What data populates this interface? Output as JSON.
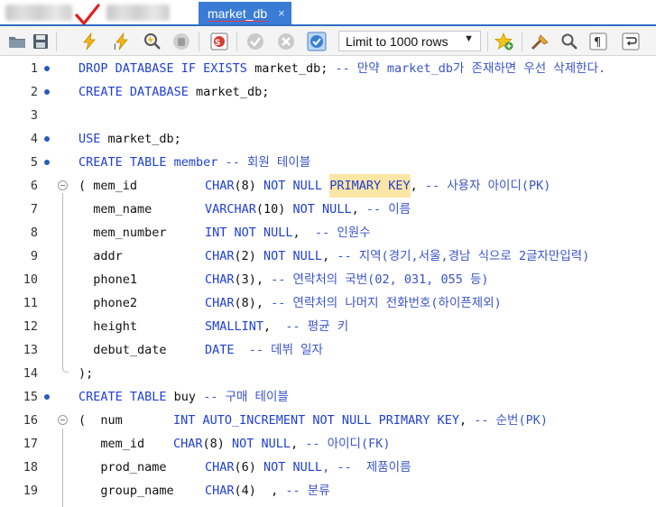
{
  "tabs": [
    {
      "label": "market_db",
      "active": true,
      "close_glyph": "×"
    }
  ],
  "toolbar": {
    "limit_select_value": "Limit to 1000 rows",
    "icons": [
      "open-folder-icon",
      "save-icon",
      "execute-icon",
      "execute-selection-icon",
      "explain-icon",
      "stop-icon",
      "toggle-error-stop-icon",
      "commit-icon",
      "rollback-icon",
      "autocommit-icon",
      "bookmark-star-icon",
      "beautify-icon",
      "find-icon",
      "invisible-chars-icon",
      "wrap-icon"
    ]
  },
  "editor": {
    "lines": [
      {
        "num": "1",
        "bullet": true,
        "fold": false,
        "tokens": [
          {
            "t": "DROP DATABASE IF EXISTS ",
            "c": "kw"
          },
          {
            "t": "market_db; ",
            "c": ""
          },
          {
            "t": "-- 만약 market_db가 존재하면 우선 삭제한다.",
            "c": "cm"
          }
        ]
      },
      {
        "num": "2",
        "bullet": true,
        "fold": false,
        "tokens": [
          {
            "t": "CREATE DATABASE ",
            "c": "kw"
          },
          {
            "t": "market_db;",
            "c": ""
          }
        ]
      },
      {
        "num": "3",
        "bullet": false,
        "fold": false,
        "tokens": []
      },
      {
        "num": "4",
        "bullet": true,
        "fold": false,
        "tokens": [
          {
            "t": "USE ",
            "c": "kw"
          },
          {
            "t": "market_db;",
            "c": ""
          }
        ]
      },
      {
        "num": "5",
        "bullet": true,
        "fold": false,
        "tokens": [
          {
            "t": "CREATE TABLE ",
            "c": "kw"
          },
          {
            "t": "member ",
            "c": "kw"
          },
          {
            "t": "-- 회원 테이블",
            "c": "cm"
          }
        ]
      },
      {
        "num": "6",
        "bullet": false,
        "fold": true,
        "tokens": [
          {
            "t": "( mem_id",
            "c": ""
          },
          {
            "t": "CHAR",
            "c": "kw",
            "col": 227
          },
          {
            "t": "(8) ",
            "c": ""
          },
          {
            "t": "NOT NULL ",
            "c": "kw"
          },
          {
            "t": "PRIMARY KEY",
            "c": "kw hl"
          },
          {
            "t": ", ",
            "c": ""
          },
          {
            "t": "-- 사용자 아이디(PK)",
            "c": "cm"
          }
        ]
      },
      {
        "num": "7",
        "bullet": false,
        "fold": false,
        "tokens": [
          {
            "t": "  mem_name",
            "c": ""
          },
          {
            "t": "VARCHAR",
            "c": "kw",
            "col": 227
          },
          {
            "t": "(10) ",
            "c": ""
          },
          {
            "t": "NOT NULL",
            "c": "kw"
          },
          {
            "t": ", ",
            "c": ""
          },
          {
            "t": "-- 이름",
            "c": "cm"
          }
        ]
      },
      {
        "num": "8",
        "bullet": false,
        "fold": false,
        "tokens": [
          {
            "t": "  mem_number",
            "c": ""
          },
          {
            "t": "INT NOT NULL",
            "c": "kw",
            "col": 227
          },
          {
            "t": ",  ",
            "c": ""
          },
          {
            "t": "-- 인원수",
            "c": "cm"
          }
        ]
      },
      {
        "num": "9",
        "bullet": false,
        "fold": false,
        "tokens": [
          {
            "t": "  addr",
            "c": ""
          },
          {
            "t": "CHAR",
            "c": "kw",
            "col": 227
          },
          {
            "t": "(2) ",
            "c": ""
          },
          {
            "t": "NOT NULL",
            "c": "kw"
          },
          {
            "t": ", ",
            "c": ""
          },
          {
            "t": "-- 지역(경기,서울,경남 식으로 2글자만입력)",
            "c": "cm"
          }
        ]
      },
      {
        "num": "10",
        "bullet": false,
        "fold": false,
        "tokens": [
          {
            "t": "  phone1",
            "c": ""
          },
          {
            "t": "CHAR",
            "c": "kw",
            "col": 227
          },
          {
            "t": "(3), ",
            "c": ""
          },
          {
            "t": "-- 연락처의 국번(02, 031, 055 등)",
            "c": "cm"
          }
        ]
      },
      {
        "num": "11",
        "bullet": false,
        "fold": false,
        "tokens": [
          {
            "t": "  phone2",
            "c": ""
          },
          {
            "t": "CHAR",
            "c": "kw",
            "col": 227
          },
          {
            "t": "(8), ",
            "c": ""
          },
          {
            "t": "-- 연락처의 나머지 전화번호(하이픈제외)",
            "c": "cm"
          }
        ]
      },
      {
        "num": "12",
        "bullet": false,
        "fold": false,
        "tokens": [
          {
            "t": "  height",
            "c": ""
          },
          {
            "t": "SMALLINT",
            "c": "kw",
            "col": 227
          },
          {
            "t": ",  ",
            "c": ""
          },
          {
            "t": "-- 평균 키",
            "c": "cm"
          }
        ]
      },
      {
        "num": "13",
        "bullet": false,
        "fold": false,
        "tokens": [
          {
            "t": "  debut_date",
            "c": ""
          },
          {
            "t": "DATE",
            "c": "kw",
            "col": 227
          },
          {
            "t": "  ",
            "c": ""
          },
          {
            "t": "-- 데뷔 일자",
            "c": "cm"
          }
        ]
      },
      {
        "num": "14",
        "bullet": false,
        "fold": false,
        "tokens": [
          {
            "t": ");",
            "c": ""
          }
        ]
      },
      {
        "num": "15",
        "bullet": true,
        "fold": false,
        "tokens": [
          {
            "t": "CREATE TABLE ",
            "c": "kw"
          },
          {
            "t": "buy ",
            "c": ""
          },
          {
            "t": "-- 구매 테이블",
            "c": "cm"
          }
        ]
      },
      {
        "num": "16",
        "bullet": false,
        "fold": true,
        "tokens": [
          {
            "t": "(  num",
            "c": ""
          },
          {
            "t": "INT AUTO_INCREMENT NOT NULL PRIMARY KEY",
            "c": "kw",
            "col": 192
          },
          {
            "t": ", ",
            "c": ""
          },
          {
            "t": "-- 순번(PK)",
            "c": "cm"
          }
        ]
      },
      {
        "num": "17",
        "bullet": false,
        "fold": false,
        "tokens": [
          {
            "t": "   mem_id",
            "c": ""
          },
          {
            "t": "CHAR",
            "c": "kw",
            "col": 192
          },
          {
            "t": "(8) ",
            "c": ""
          },
          {
            "t": "NOT NULL",
            "c": "kw"
          },
          {
            "t": ", ",
            "c": ""
          },
          {
            "t": "-- 아이디(FK)",
            "c": "cm"
          }
        ]
      },
      {
        "num": "18",
        "bullet": false,
        "fold": false,
        "tokens": [
          {
            "t": "   prod_name",
            "c": ""
          },
          {
            "t": "CHAR",
            "c": "kw",
            "col": 227
          },
          {
            "t": "(6) ",
            "c": ""
          },
          {
            "t": "NOT NULL",
            "c": "kw"
          },
          {
            "t": ", --  ",
            "c": "cm"
          },
          {
            "t": "제품이름",
            "c": "cm"
          }
        ]
      },
      {
        "num": "19",
        "bullet": false,
        "fold": false,
        "tokens": [
          {
            "t": "   group_name",
            "c": ""
          },
          {
            "t": "CHAR",
            "c": "kw",
            "col": 227
          },
          {
            "t": "(4)  ",
            "c": ""
          },
          {
            "t": ", ",
            "c": ""
          },
          {
            "t": "-- 분류",
            "c": "cm"
          }
        ]
      }
    ]
  }
}
